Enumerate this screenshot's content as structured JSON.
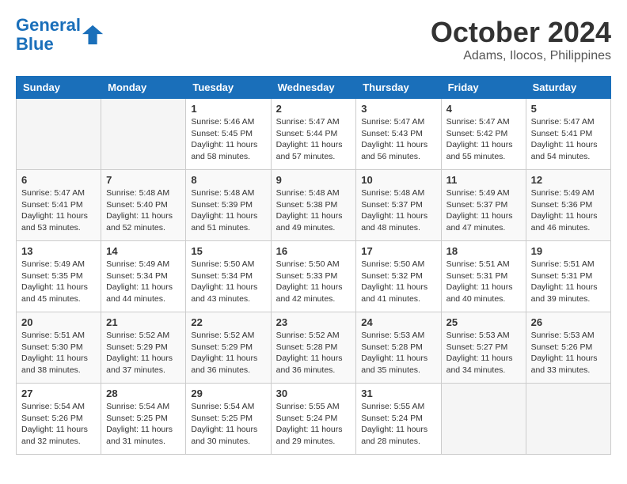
{
  "logo": {
    "line1": "General",
    "line2": "Blue"
  },
  "title": "October 2024",
  "subtitle": "Adams, Ilocos, Philippines",
  "weekdays": [
    "Sunday",
    "Monday",
    "Tuesday",
    "Wednesday",
    "Thursday",
    "Friday",
    "Saturday"
  ],
  "weeks": [
    [
      {
        "day": "",
        "info": ""
      },
      {
        "day": "",
        "info": ""
      },
      {
        "day": "1",
        "info": "Sunrise: 5:46 AM\nSunset: 5:45 PM\nDaylight: 11 hours and 58 minutes."
      },
      {
        "day": "2",
        "info": "Sunrise: 5:47 AM\nSunset: 5:44 PM\nDaylight: 11 hours and 57 minutes."
      },
      {
        "day": "3",
        "info": "Sunrise: 5:47 AM\nSunset: 5:43 PM\nDaylight: 11 hours and 56 minutes."
      },
      {
        "day": "4",
        "info": "Sunrise: 5:47 AM\nSunset: 5:42 PM\nDaylight: 11 hours and 55 minutes."
      },
      {
        "day": "5",
        "info": "Sunrise: 5:47 AM\nSunset: 5:41 PM\nDaylight: 11 hours and 54 minutes."
      }
    ],
    [
      {
        "day": "6",
        "info": "Sunrise: 5:47 AM\nSunset: 5:41 PM\nDaylight: 11 hours and 53 minutes."
      },
      {
        "day": "7",
        "info": "Sunrise: 5:48 AM\nSunset: 5:40 PM\nDaylight: 11 hours and 52 minutes."
      },
      {
        "day": "8",
        "info": "Sunrise: 5:48 AM\nSunset: 5:39 PM\nDaylight: 11 hours and 51 minutes."
      },
      {
        "day": "9",
        "info": "Sunrise: 5:48 AM\nSunset: 5:38 PM\nDaylight: 11 hours and 49 minutes."
      },
      {
        "day": "10",
        "info": "Sunrise: 5:48 AM\nSunset: 5:37 PM\nDaylight: 11 hours and 48 minutes."
      },
      {
        "day": "11",
        "info": "Sunrise: 5:49 AM\nSunset: 5:37 PM\nDaylight: 11 hours and 47 minutes."
      },
      {
        "day": "12",
        "info": "Sunrise: 5:49 AM\nSunset: 5:36 PM\nDaylight: 11 hours and 46 minutes."
      }
    ],
    [
      {
        "day": "13",
        "info": "Sunrise: 5:49 AM\nSunset: 5:35 PM\nDaylight: 11 hours and 45 minutes."
      },
      {
        "day": "14",
        "info": "Sunrise: 5:49 AM\nSunset: 5:34 PM\nDaylight: 11 hours and 44 minutes."
      },
      {
        "day": "15",
        "info": "Sunrise: 5:50 AM\nSunset: 5:34 PM\nDaylight: 11 hours and 43 minutes."
      },
      {
        "day": "16",
        "info": "Sunrise: 5:50 AM\nSunset: 5:33 PM\nDaylight: 11 hours and 42 minutes."
      },
      {
        "day": "17",
        "info": "Sunrise: 5:50 AM\nSunset: 5:32 PM\nDaylight: 11 hours and 41 minutes."
      },
      {
        "day": "18",
        "info": "Sunrise: 5:51 AM\nSunset: 5:31 PM\nDaylight: 11 hours and 40 minutes."
      },
      {
        "day": "19",
        "info": "Sunrise: 5:51 AM\nSunset: 5:31 PM\nDaylight: 11 hours and 39 minutes."
      }
    ],
    [
      {
        "day": "20",
        "info": "Sunrise: 5:51 AM\nSunset: 5:30 PM\nDaylight: 11 hours and 38 minutes."
      },
      {
        "day": "21",
        "info": "Sunrise: 5:52 AM\nSunset: 5:29 PM\nDaylight: 11 hours and 37 minutes."
      },
      {
        "day": "22",
        "info": "Sunrise: 5:52 AM\nSunset: 5:29 PM\nDaylight: 11 hours and 36 minutes."
      },
      {
        "day": "23",
        "info": "Sunrise: 5:52 AM\nSunset: 5:28 PM\nDaylight: 11 hours and 36 minutes."
      },
      {
        "day": "24",
        "info": "Sunrise: 5:53 AM\nSunset: 5:28 PM\nDaylight: 11 hours and 35 minutes."
      },
      {
        "day": "25",
        "info": "Sunrise: 5:53 AM\nSunset: 5:27 PM\nDaylight: 11 hours and 34 minutes."
      },
      {
        "day": "26",
        "info": "Sunrise: 5:53 AM\nSunset: 5:26 PM\nDaylight: 11 hours and 33 minutes."
      }
    ],
    [
      {
        "day": "27",
        "info": "Sunrise: 5:54 AM\nSunset: 5:26 PM\nDaylight: 11 hours and 32 minutes."
      },
      {
        "day": "28",
        "info": "Sunrise: 5:54 AM\nSunset: 5:25 PM\nDaylight: 11 hours and 31 minutes."
      },
      {
        "day": "29",
        "info": "Sunrise: 5:54 AM\nSunset: 5:25 PM\nDaylight: 11 hours and 30 minutes."
      },
      {
        "day": "30",
        "info": "Sunrise: 5:55 AM\nSunset: 5:24 PM\nDaylight: 11 hours and 29 minutes."
      },
      {
        "day": "31",
        "info": "Sunrise: 5:55 AM\nSunset: 5:24 PM\nDaylight: 11 hours and 28 minutes."
      },
      {
        "day": "",
        "info": ""
      },
      {
        "day": "",
        "info": ""
      }
    ]
  ]
}
